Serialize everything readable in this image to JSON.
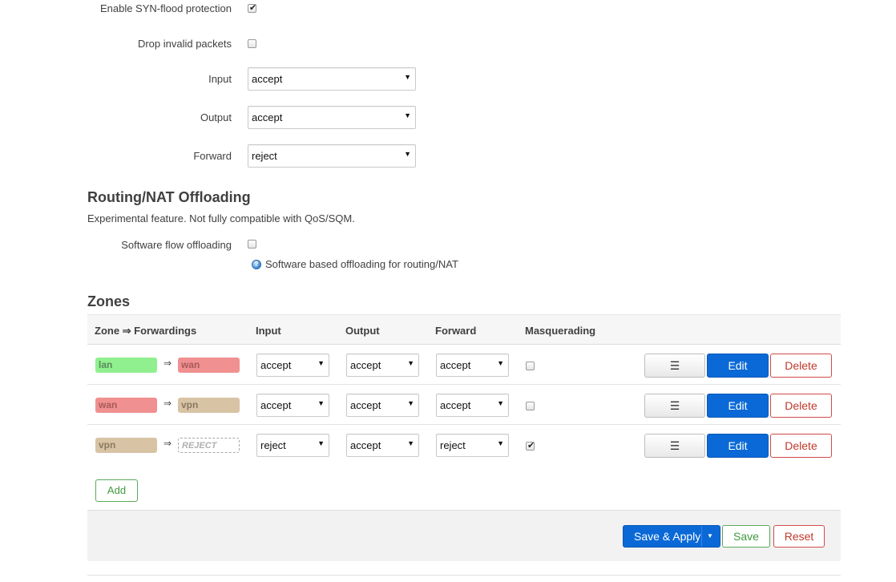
{
  "general": {
    "syn_flood_label": "Enable SYN-flood protection",
    "syn_flood_checked": true,
    "drop_invalid_label": "Drop invalid packets",
    "drop_invalid_checked": false,
    "input_label": "Input",
    "input_value": "accept",
    "output_label": "Output",
    "output_value": "accept",
    "forward_label": "Forward",
    "forward_value": "reject"
  },
  "offloading": {
    "title": "Routing/NAT Offloading",
    "description": "Experimental feature. Not fully compatible with QoS/SQM.",
    "sw_flow_label": "Software flow offloading",
    "sw_flow_checked": false,
    "sw_flow_hint": "Software based offloading for routing/NAT"
  },
  "zones": {
    "title": "Zones",
    "headers": {
      "zone_forwardings": "Zone ⇒ Forwardings",
      "input": "Input",
      "output": "Output",
      "forward": "Forward",
      "masquerading": "Masquerading"
    },
    "rows": [
      {
        "zone": "lan",
        "zone_color": "#90f090",
        "arrow": "⇒",
        "dest": "wan",
        "dest_color": "#f09090",
        "dest_reject": false,
        "input": "accept",
        "output": "accept",
        "forward": "accept",
        "masq": false
      },
      {
        "zone": "wan",
        "zone_color": "#f09090",
        "arrow": "⇒",
        "dest": "vpn",
        "dest_color": "#d8c3a5",
        "dest_reject": false,
        "input": "accept",
        "output": "accept",
        "forward": "accept",
        "masq": false
      },
      {
        "zone": "vpn",
        "zone_color": "#d8c3a5",
        "arrow": "⇒",
        "dest": "REJECT",
        "dest_color": "#ffffff",
        "dest_reject": true,
        "input": "reject",
        "output": "accept",
        "forward": "reject",
        "masq": true
      }
    ],
    "menu_label": "☰",
    "edit_label": "Edit",
    "delete_label": "Delete",
    "add_label": "Add"
  },
  "footer": {
    "save_apply_label": "Save & Apply",
    "save_label": "Save",
    "reset_label": "Reset"
  },
  "icons": {
    "select_arrow": "▼",
    "checkmark": "✔",
    "info": "?"
  }
}
